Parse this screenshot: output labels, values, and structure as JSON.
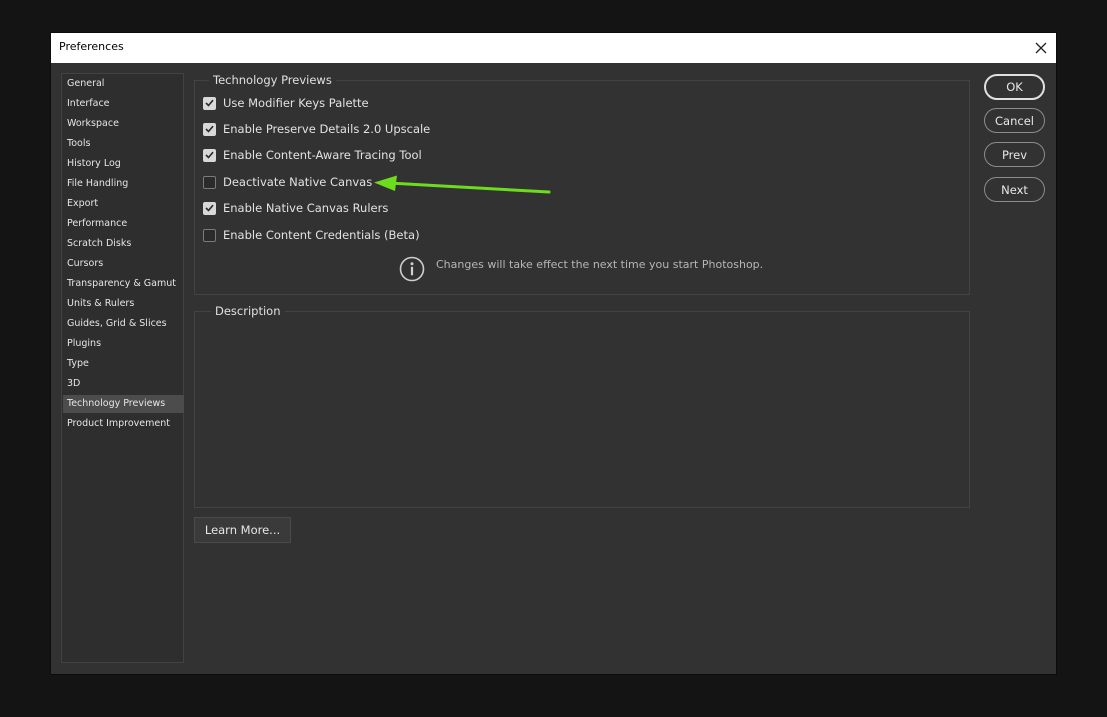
{
  "window": {
    "title": "Preferences",
    "close_icon": "close-icon"
  },
  "sidebar": {
    "selected_index": 16,
    "items": [
      "General",
      "Interface",
      "Workspace",
      "Tools",
      "History Log",
      "File Handling",
      "Export",
      "Performance",
      "Scratch Disks",
      "Cursors",
      "Transparency & Gamut",
      "Units & Rulers",
      "Guides, Grid & Slices",
      "Plugins",
      "Type",
      "3D",
      "Technology Previews",
      "Product Improvement"
    ]
  },
  "tech_previews": {
    "group_label": "Technology Previews",
    "options": [
      {
        "label": "Use Modifier Keys Palette",
        "checked": true
      },
      {
        "label": "Enable Preserve Details 2.0 Upscale",
        "checked": true
      },
      {
        "label": "Enable Content-Aware Tracing Tool",
        "checked": true
      },
      {
        "label": "Deactivate Native Canvas",
        "checked": false
      },
      {
        "label": "Enable Native Canvas Rulers",
        "checked": true
      },
      {
        "label": "Enable Content Credentials (Beta)",
        "checked": false
      }
    ],
    "info_icon": "info-icon",
    "info_text": "Changes will take effect the next time you start Photoshop."
  },
  "description": {
    "group_label": "Description"
  },
  "buttons": {
    "ok": "OK",
    "cancel": "Cancel",
    "prev": "Prev",
    "next": "Next",
    "learn_more": "Learn More..."
  },
  "annotation": {
    "arrow_color": "#6ddc1c"
  },
  "colors": {
    "dialog_bg": "#323232",
    "selected_item": "#4c4c4c",
    "page_bg": "#141414"
  }
}
